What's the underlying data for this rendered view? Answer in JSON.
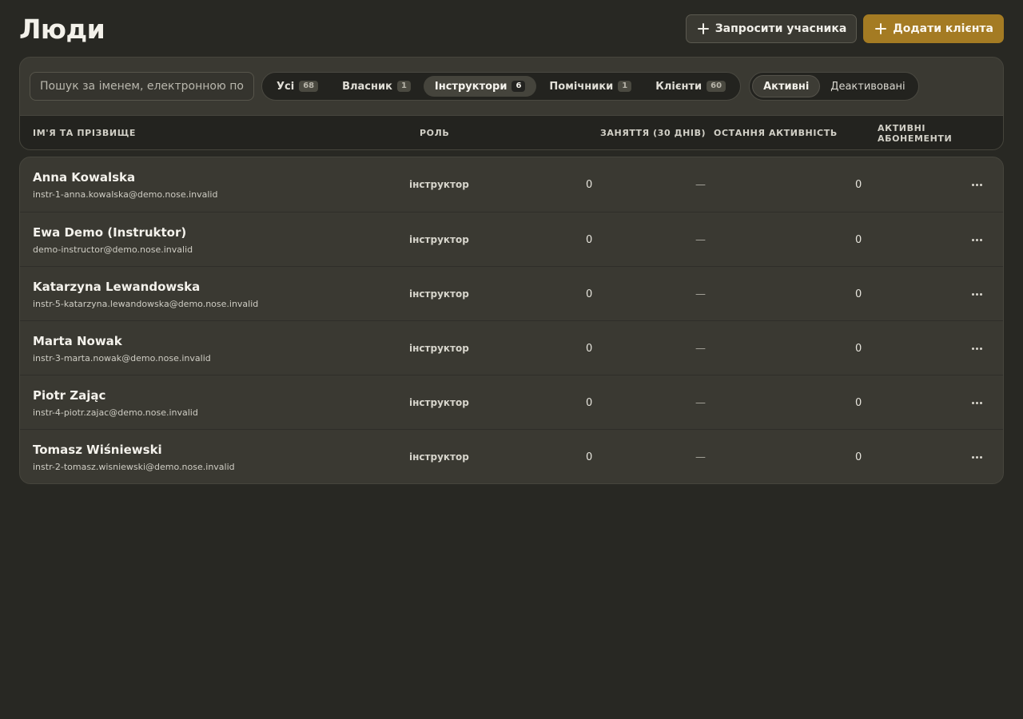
{
  "header": {
    "title": "Люди",
    "invite_label": "Запросити учасника",
    "add_client_label": "Додати клієнта"
  },
  "toolbar": {
    "search_placeholder": "Пошук за іменем, електронною поштою",
    "tabs": [
      {
        "label": "Усі",
        "count": "68"
      },
      {
        "label": "Власник",
        "count": "1"
      },
      {
        "label": "Інструктори",
        "count": "6"
      },
      {
        "label": "Помічники",
        "count": "1"
      },
      {
        "label": "Клієнти",
        "count": "60"
      }
    ],
    "active_tab": "Інструктори",
    "status": {
      "active": "Активні",
      "deactivated": "Деактивовані"
    }
  },
  "table": {
    "columns": {
      "name": "ІМ'Я ТА ПРІЗВИЩЕ",
      "role": "РОЛЬ",
      "classes": "ЗАНЯТТЯ (30 ДНІВ)",
      "last_activity": "ОСТАННЯ АКТИВНІСТЬ",
      "memberships": "АКТИВНІ АБОНЕМЕНТИ"
    },
    "rows": [
      {
        "name": "Anna Kowalska",
        "email": "instr-1-anna.kowalska@demo.nose.invalid",
        "role": "інструктор",
        "classes": "0",
        "last_activity": "—",
        "memberships": "0"
      },
      {
        "name": "Ewa Demo (Instruktor)",
        "email": "demo-instructor@demo.nose.invalid",
        "role": "інструктор",
        "classes": "0",
        "last_activity": "—",
        "memberships": "0"
      },
      {
        "name": "Katarzyna Lewandowska",
        "email": "instr-5-katarzyna.lewandowska@demo.nose.invalid",
        "role": "інструктор",
        "classes": "0",
        "last_activity": "—",
        "memberships": "0"
      },
      {
        "name": "Marta Nowak",
        "email": "instr-3-marta.nowak@demo.nose.invalid",
        "role": "інструктор",
        "classes": "0",
        "last_activity": "—",
        "memberships": "0"
      },
      {
        "name": "Piotr Zając",
        "email": "instr-4-piotr.zajac@demo.nose.invalid",
        "role": "інструктор",
        "classes": "0",
        "last_activity": "—",
        "memberships": "0"
      },
      {
        "name": "Tomasz Wiśniewski",
        "email": "instr-2-tomasz.wisniewski@demo.nose.invalid",
        "role": "інструктор",
        "classes": "0",
        "last_activity": "—",
        "memberships": "0"
      }
    ]
  },
  "colors": {
    "background": "#282823",
    "panel": "#3a3932",
    "accent": "#a47b23"
  }
}
